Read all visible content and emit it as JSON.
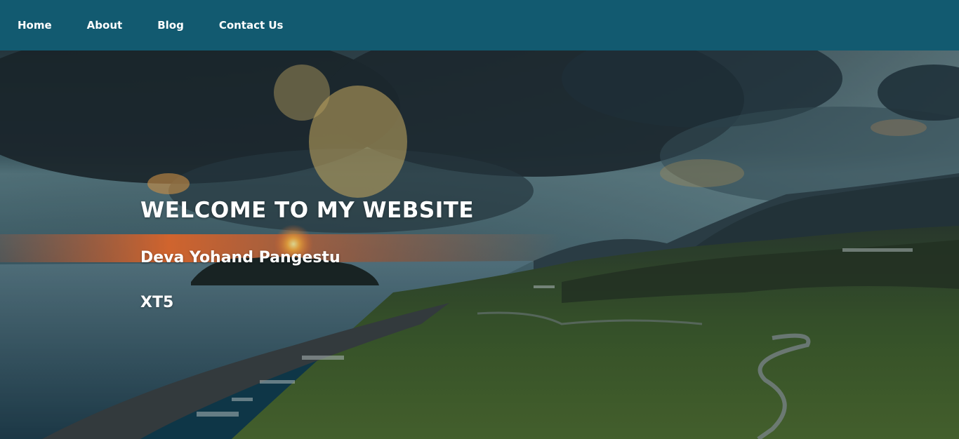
{
  "nav": {
    "items": [
      {
        "label": "Home"
      },
      {
        "label": "About"
      },
      {
        "label": "Blog"
      },
      {
        "label": "Contact Us"
      }
    ]
  },
  "hero": {
    "title": "WELCOME TO MY WEBSITE",
    "name": "Deva Yohand Pangestu",
    "class_label": "XT5",
    "background_image": "coastal-sunset-landscape"
  },
  "colors": {
    "navbar": "#125a70",
    "text": "#ffffff",
    "sky_dark": "#1e2c33",
    "sunset": "#f26a2a",
    "sea": "#2e5566",
    "hills": "#3f5a2a"
  }
}
